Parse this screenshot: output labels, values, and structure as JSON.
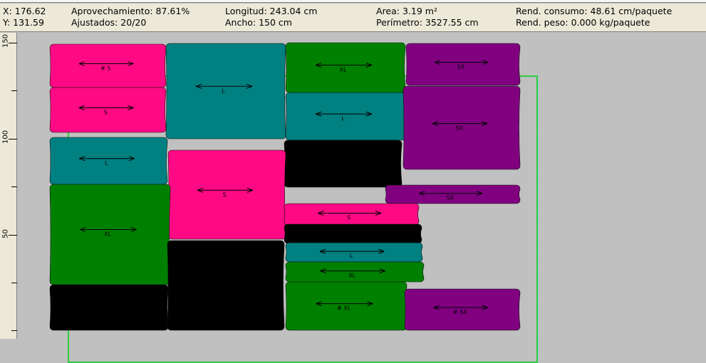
{
  "status": {
    "x": "X: 176.62",
    "y": "Y: 131.59",
    "aprovechamiento": "Aprovechamiento: 87.61%",
    "ajustados": "Ajustados: 20/20",
    "longitud": "Longitud: 243.04 cm",
    "ancho": "Ancho: 150 cm",
    "area": "Area: 3.19 m²",
    "perimetro": "Perímetro: 3527.55 cm",
    "rend_consumo": "Rend. consumo: 48.61 cm/paquete",
    "rend_peso": "Rend. peso: 0.000 kg/paquete"
  },
  "ruler": {
    "labels": [
      "150",
      "100",
      "50"
    ]
  },
  "colors": {
    "pink": "#ff0a84",
    "teal": "#008080",
    "green": "#008000",
    "black": "#000000",
    "purple": "#800080",
    "marker_border": "#2ecc40",
    "fabric": "#c0c0c0"
  },
  "pieces": [
    {
      "color": "pink",
      "label": "# S"
    },
    {
      "color": "pink",
      "label": "S"
    },
    {
      "color": "teal",
      "label": "L"
    },
    {
      "color": "green",
      "label": "XL"
    },
    {
      "color": "purple",
      "label": "SX"
    },
    {
      "color": "teal",
      "label": "L"
    },
    {
      "color": "purple",
      "label": "SX"
    },
    {
      "color": "teal",
      "label": "L"
    },
    {
      "color": "black",
      "label": ""
    },
    {
      "color": "pink",
      "label": "S"
    },
    {
      "color": "purple",
      "label": "SX"
    },
    {
      "color": "green",
      "label": "XL"
    },
    {
      "color": "pink",
      "label": "S"
    },
    {
      "color": "black",
      "label": ""
    },
    {
      "color": "teal",
      "label": "L"
    },
    {
      "color": "green",
      "label": "XL"
    },
    {
      "color": "black",
      "label": ""
    },
    {
      "color": "black",
      "label": ""
    },
    {
      "color": "green",
      "label": "# XL"
    },
    {
      "color": "purple",
      "label": "# SX"
    }
  ]
}
